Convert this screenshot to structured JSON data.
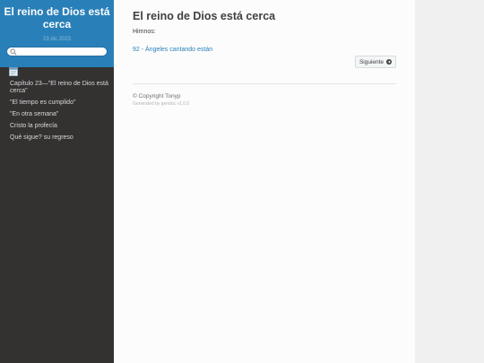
{
  "sidebar": {
    "title": "El reino de Dios está cerca",
    "date": "23 dic 2023",
    "search": {
      "placeholder": "",
      "value": ""
    },
    "items": [
      {
        "label": "Capítulo 23—\"El reino de Dios está cerca\""
      },
      {
        "label": "\"El tiempo es cumplido\""
      },
      {
        "label": "\"En otra semana\""
      },
      {
        "label": "Cristo la profecía"
      },
      {
        "label": "Qué sigue? su regreso"
      }
    ]
  },
  "main": {
    "title": "El reino de Dios está cerca",
    "hymns_label": "Himnos:",
    "hymn_link": "92 - Ángeles cantando están",
    "next_button": "Siguiente",
    "copyright": "© Copyright Tonyp",
    "generated": "Generated by gendoc v1.0.0"
  },
  "colors": {
    "accent": "#2980b9",
    "sidebar_bg": "#343131",
    "content_bg": "#fcfcfc"
  },
  "icons": {
    "search": "search-icon",
    "book": "book-icon",
    "next": "circle-arrow-right-icon"
  }
}
